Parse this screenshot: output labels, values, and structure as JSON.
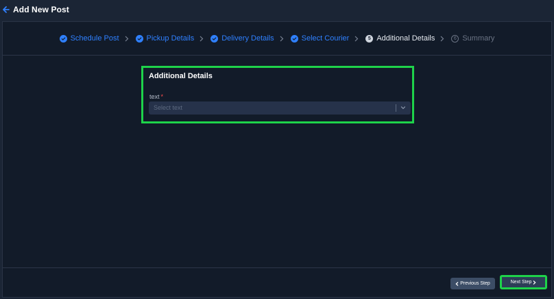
{
  "header": {
    "title": "Add New Post"
  },
  "stepper": {
    "steps": [
      {
        "label": "Schedule Post",
        "state": "done"
      },
      {
        "label": "Pickup Details",
        "state": "done"
      },
      {
        "label": "Delivery Details",
        "state": "done"
      },
      {
        "label": "Select Courier",
        "state": "done"
      },
      {
        "label": "Additional Details",
        "state": "active",
        "number": "5"
      },
      {
        "label": "Summary",
        "state": "pending",
        "number": "6"
      }
    ]
  },
  "form": {
    "title": "Additional Details",
    "field_label": "text",
    "required_mark": "*",
    "select_placeholder": "Select text"
  },
  "footer": {
    "previous_label": "Previous Step",
    "next_label": "Next Step"
  },
  "colors": {
    "accent": "#2f80ff",
    "highlight": "#1ed34a",
    "panel": "#121b29",
    "required": "#ff4d4d"
  }
}
